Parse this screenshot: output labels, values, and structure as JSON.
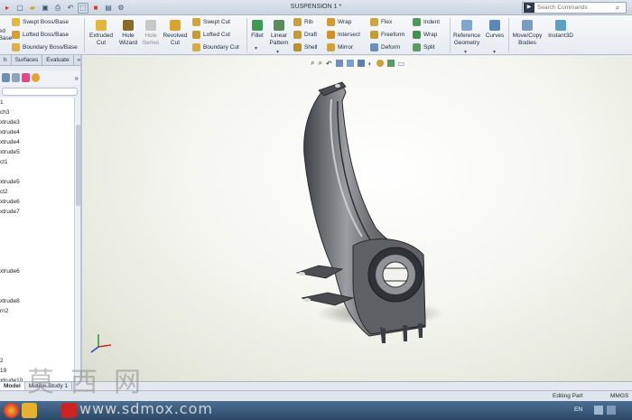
{
  "window": {
    "title": "SUSPENSION 1 *"
  },
  "search": {
    "placeholder": "Search Commands"
  },
  "ribbon": {
    "boss_base_label": "ed\nBase",
    "swept_boss": "Swept Boss/Base",
    "lofted_boss": "Lofted Boss/Base",
    "boundary_boss": "Boundary Boss/Base",
    "extruded_cut": "Extruded\nCut",
    "hole_wizard": "Hole\nWizard",
    "hole_series": "Hole\nSeries",
    "revolved_cut": "Revolved\nCut",
    "swept_cut": "Swept Cut",
    "lofted_cut": "Lofted Cut",
    "boundary_cut": "Boundary Cut",
    "fillet": "Fillet",
    "linear_pattern": "Linear\nPattern",
    "rib": "Rib",
    "draft": "Draft",
    "shell": "Shell",
    "wrap": "Wrap",
    "intersect": "Intersect",
    "mirror": "Mirror",
    "flex": "Flex",
    "freeform": "Freeform",
    "deform": "Deform",
    "indent": "Indent",
    "wrap2": "Wrap",
    "split": "Split",
    "reference_geometry": "Reference\nGeometry",
    "curves": "Curves",
    "move_copy_bodies": "Move/Copy\nBodies",
    "instant3d": "Instant3D"
  },
  "panel_tabs": [
    "h",
    "Surfaces",
    "Evaluate"
  ],
  "feature_tree": [
    "1",
    "ch3",
    "xtrude3",
    "xtrude4",
    "xtrude4",
    "xtrude5",
    "ct1",
    "",
    "xtrude5",
    "ct2",
    "xtrude6",
    "xtrude7",
    "",
    "",
    "",
    "",
    "",
    "xtrude6",
    "",
    "",
    "xtrude8",
    "rn2",
    "",
    "",
    "",
    "",
    "2",
    "19",
    "xtrude10"
  ],
  "bottom_tabs": [
    "Model",
    "Motion Study 1"
  ],
  "status": {
    "editing": "Editing Part",
    "units": "MMGS"
  },
  "taskbar": {
    "lang": "EN"
  },
  "watermark": {
    "cn": "莫西网",
    "url": "www.sdmox.com"
  },
  "colors": {
    "accent": "#2b4866",
    "part": "#6f7378",
    "viewport_bg": "#f5f6f0"
  }
}
